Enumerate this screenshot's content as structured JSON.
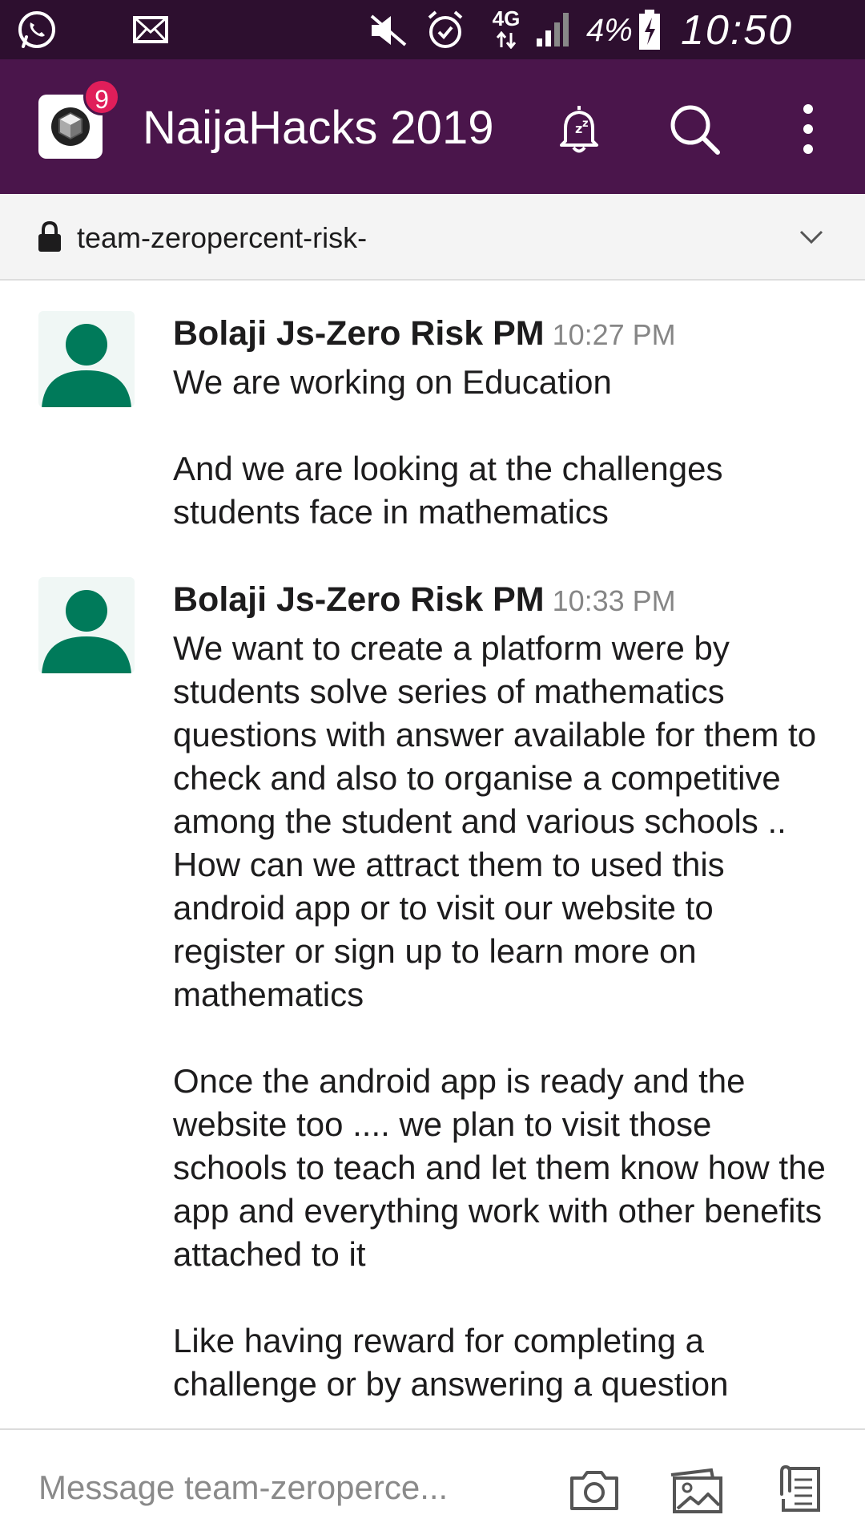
{
  "status_bar": {
    "icons": [
      "whatsapp-icon",
      "mail-icon",
      "mute-icon",
      "alarm-icon",
      "network-4g-icon",
      "signal-icon",
      "battery-charging-icon"
    ],
    "network": "4G",
    "battery": "4%",
    "clock": "10:50 PM"
  },
  "app_bar": {
    "workspace_name": "NaijaHacks 2019",
    "badge_count": "9",
    "icons": [
      "workspace-logo-icon",
      "snooze-bell-icon",
      "search-icon",
      "more-vert-icon"
    ]
  },
  "channel": {
    "name": "team-zeropercent-risk-"
  },
  "messages": [
    {
      "author": "Bolaji Js-Zero Risk PM",
      "time": "10:27 PM",
      "paragraphs": [
        "We are working on Education",
        "And we are looking at the challenges students face in mathematics"
      ]
    },
    {
      "author": "Bolaji Js-Zero Risk PM",
      "time": "10:33 PM",
      "paragraphs": [
        "We want to create a platform were by students solve series of mathematics questions with answer available for them to check and also to  organise a competitive among the student and various schools ..",
        "How can we attract them to used this android app or to visit our website to register or sign up to learn more on mathematics",
        "Once the android app is ready and the website too .... we plan to visit those schools to teach and let them know how the app and everything work with other benefits attached to it",
        "Like having reward for completing a challenge or by answering a question"
      ]
    }
  ],
  "composer": {
    "placeholder": "Message team-zeroperce..."
  },
  "colors": {
    "status_bar": "#2d0f2f",
    "app_bar": "#4a154b",
    "badge": "#e01e5a",
    "avatar": "#007a5a"
  }
}
